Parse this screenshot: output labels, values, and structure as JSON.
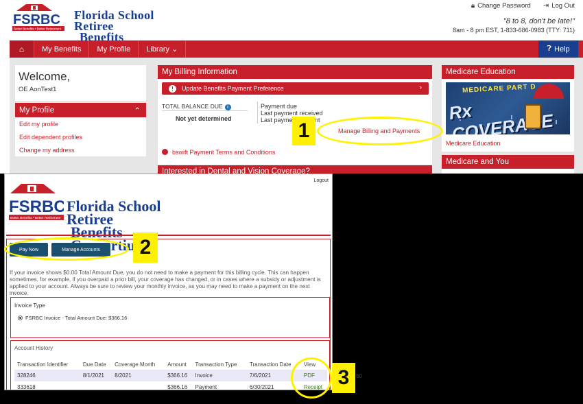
{
  "top": {
    "logo": {
      "abbr": "FSRBC",
      "line1": "Florida School Retiree",
      "line2": "Benefits Consortium",
      "tagline": "Better Benefits • Better Retirement"
    },
    "links": {
      "change_password": "Change Password",
      "log_out": "Log Out"
    },
    "slogan": "\"8 to 8, don't be late!\"",
    "hours": "8am - 8 pm EST, 1-833-686-0983 (TTY: 711)",
    "nav": {
      "home_icon": "home-icon",
      "items": [
        "My Benefits",
        "My Profile",
        "Library"
      ],
      "help": "Help"
    },
    "welcome": {
      "title": "Welcome,",
      "user": "OE AonTest1"
    },
    "profile": {
      "title": "My Profile",
      "links": [
        "Edit my profile",
        "Edit dependent profiles",
        "Change my address"
      ]
    },
    "billing": {
      "title": "My Billing Information",
      "pref_button": "Update Benefits Payment Preference",
      "balance_label": "TOTAL BALANCE DUE",
      "balance_value": "Not yet determined",
      "payment_due": "Payment due",
      "last_received": "Last payment received",
      "last_amount": "Last payment amount",
      "manage_link": "Manage Billing and Payments",
      "terms_link": "bswift Payment Terms and Conditions"
    },
    "dental_title": "Interested in Dental and Vision Coverage?",
    "medicare_ed": {
      "title": "Medicare Education",
      "img_top": "MEDICARE PART D",
      "img_main": "Rx COVERAGE",
      "caption": "Medicare Education"
    },
    "medicare_you": {
      "title": "Medicare and You"
    }
  },
  "bottom": {
    "logout": "Logout",
    "logo": {
      "abbr": "FSRBC",
      "line1": "Florida School Retiree",
      "line2": "Benefits Consortium",
      "tagline": "Better Benefits • Better Retirement"
    },
    "buttons": {
      "pay_now": "Pay Now",
      "manage_accounts": "Manage Accounts"
    },
    "note": "If your invoice shows $0.00 Total Amount Due, you do not need to make a payment for this billing cycle. This can happen sometimes, for example, if you overpaid a prior bill, your coverage has changed, or in cases where a subsidy or adjustment is applied to your account. Always be sure to review your monthly invoice, as you may need to make a payment on the next invoice.",
    "invoice_type": {
      "label": "Invoice Type",
      "option": "FSRBC Invoice - Total Amount Due: $366.16"
    },
    "history": {
      "label": "Account History",
      "columns": [
        "Transaction Identifier",
        "Due Date",
        "Coverage Month",
        "Amount",
        "Transaction Type",
        "Transaction Date",
        "View"
      ],
      "rows": [
        [
          "328246",
          "8/1/2021",
          "8/2021",
          "$366.16",
          "Invoice",
          "7/6/2021",
          "PDF"
        ],
        [
          "333618",
          "",
          "",
          "$366.16",
          "Payment",
          "6/30/2021",
          "Receipt"
        ]
      ]
    },
    "stray_text": "50"
  },
  "annotations": {
    "step1": "1",
    "step2": "2",
    "step3": "3",
    "highlight_color": "#fff200"
  }
}
